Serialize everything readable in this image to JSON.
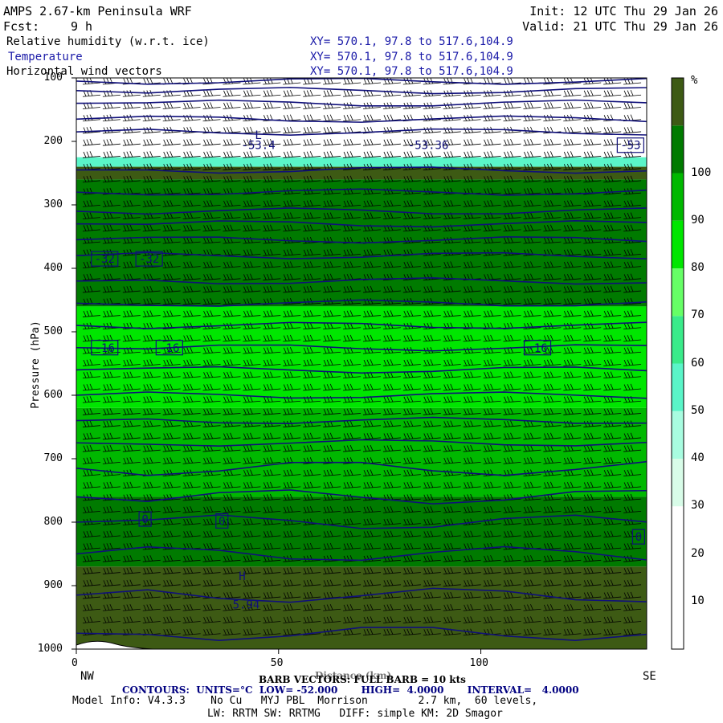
{
  "header": {
    "title": "AMPS 2.67-km Peninsula WRF",
    "fcst_label": "Fcst:",
    "fcst_value": "9 h",
    "init": "Init: 12 UTC Thu 29 Jan 26",
    "valid": "Valid: 21 UTC Thu 29 Jan 26",
    "fields": [
      {
        "name": "Relative humidity (w.r.t. ice)",
        "xy": "XY= 570.1, 97.8 to 517.6,104.9"
      },
      {
        "name": "Temperature",
        "xy": "XY= 570.1, 97.8 to 517.6,104.9"
      },
      {
        "name": "Horizontal wind vectors",
        "xy": "XY= 570.1, 97.8 to 517.6,104.9"
      }
    ]
  },
  "footer": {
    "left_end": "NW",
    "right_end": "SE",
    "barb_note": "BARB VECTORS: FULL BARB = 10 kts",
    "xlabel_overlap": "Distance (km)",
    "contours": "CONTOURS:  UNITS=°C  LOW= -52.000       HIGH=  4.0000       INTERVAL=   4.0000",
    "model_info": "Model Info: V4.3.3    No Cu   MYJ PBL  Morrison        2.7 km,  60 levels,",
    "physics": "LW: RRTM SW: RRTMG   DIFF: simple KM: 2D Smagor"
  },
  "chart_data": {
    "type": "heatmap",
    "title": "Relative humidity (w.r.t. ice), Temperature, Horizontal wind vectors",
    "xlabel": "Distance (km)",
    "ylabel": "Pressure (hPa)",
    "xlim": [
      0,
      141
    ],
    "ylim": [
      1000,
      100
    ],
    "x_ticks": [
      0,
      50,
      100
    ],
    "y_ticks": [
      100,
      200,
      300,
      400,
      500,
      600,
      700,
      800,
      900,
      1000
    ],
    "colorbar": {
      "unit": "%",
      "ticks": [
        10,
        20,
        30,
        40,
        50,
        60,
        70,
        80,
        90,
        100
      ],
      "colors": [
        "#ffffff",
        "#ffffff",
        "#ffffff",
        "#d8fce8",
        "#a8fce0",
        "#5af5c8",
        "#3aeb8a",
        "#66ff66",
        "#00e600",
        "#00b800",
        "#007a00",
        "#3d5a14"
      ]
    },
    "rh_layers_by_pressure": [
      {
        "p_range": [
          100,
          225
        ],
        "rh_percent": 5
      },
      {
        "p_range": [
          225,
          240
        ],
        "rh_percent": 45
      },
      {
        "p_range": [
          240,
          260
        ],
        "rh_percent": 100
      },
      {
        "p_range": [
          260,
          460
        ],
        "rh_percent": 95
      },
      {
        "p_range": [
          460,
          620
        ],
        "rh_percent": 78
      },
      {
        "p_range": [
          620,
          760
        ],
        "rh_percent": 85
      },
      {
        "p_range": [
          760,
          870
        ],
        "rh_percent": 92
      },
      {
        "p_range": [
          870,
          1000
        ],
        "rh_percent": 100
      }
    ],
    "temperature_labels": [
      {
        "text": "-53.4",
        "x": 45,
        "p": 206
      },
      {
        "text": "-53.36",
        "x": 87,
        "p": 206
      },
      {
        "text": "-53",
        "x": 137,
        "p": 206
      },
      {
        "text": "-32",
        "x": 7,
        "p": 385
      },
      {
        "text": "-32",
        "x": 18,
        "p": 385
      },
      {
        "text": "-16",
        "x": 7,
        "p": 525
      },
      {
        "text": "-16",
        "x": 23,
        "p": 525
      },
      {
        "text": "-16",
        "x": 114,
        "p": 525
      },
      {
        "text": "0",
        "x": 17,
        "p": 795
      },
      {
        "text": "0",
        "x": 36,
        "p": 798
      },
      {
        "text": "0",
        "x": 139,
        "p": 823
      },
      {
        "text": "H",
        "x": 41,
        "p": 885
      },
      {
        "text": "5.94",
        "x": 42,
        "p": 930
      },
      {
        "text": "L",
        "x": 45,
        "p": 190
      }
    ],
    "isotherm_pressures": [
      105,
      120,
      140,
      165,
      185,
      245,
      280,
      310,
      330,
      355,
      380,
      420,
      455,
      490,
      525,
      560,
      600,
      640,
      675,
      715,
      760,
      800,
      850,
      915,
      975
    ]
  }
}
